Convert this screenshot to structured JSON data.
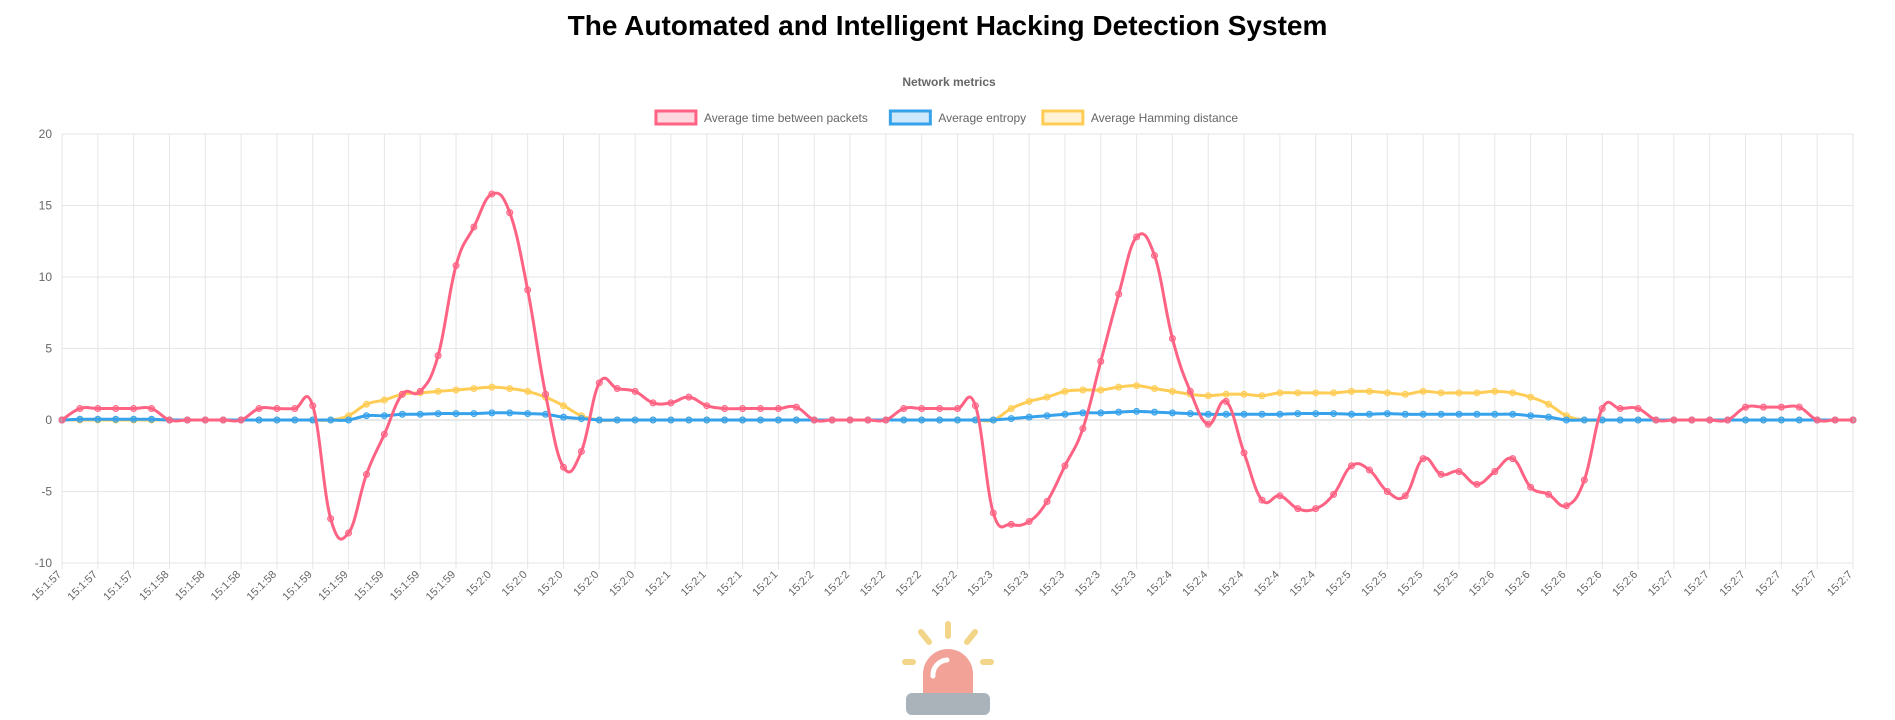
{
  "page": {
    "title": "The Automated and Intelligent Hacking Detection System"
  },
  "chart_data": {
    "type": "line",
    "title": "Network metrics",
    "xlabel": "",
    "ylabel": "",
    "ylim": [
      -10,
      20
    ],
    "yticks": [
      -10,
      -5,
      0,
      5,
      10,
      15,
      20
    ],
    "grid": true,
    "legend_position": "top",
    "categories": [
      "15:1:57",
      "15:1:57",
      "15:1:57",
      "15:1:58",
      "15:1:58",
      "15:1:58",
      "15:1:58",
      "15:1:59",
      "15:1:59",
      "15:1:59",
      "15:1:59",
      "15:1:59",
      "15:2:0",
      "15:2:0",
      "15:2:0",
      "15:2:0",
      "15:2:0",
      "15:2:1",
      "15:2:1",
      "15:2:1",
      "15:2:1",
      "15:2:2",
      "15:2:2",
      "15:2:2",
      "15:2:2",
      "15:2:2",
      "15:2:3",
      "15:2:3",
      "15:2:3",
      "15:2:3",
      "15:2:3",
      "15:2:4",
      "15:2:4",
      "15:2:4",
      "15:2:4",
      "15:2:4",
      "15:2:5",
      "15:2:5",
      "15:2:5",
      "15:2:5",
      "15:2:6",
      "15:2:6",
      "15:2:6",
      "15:2:6",
      "15:2:6",
      "15:2:7",
      "15:2:7",
      "15:2:7",
      "15:2:7",
      "15:2:7",
      "15:2:7"
    ],
    "points": [
      "15:1:57",
      "",
      "15:1:57",
      "",
      "15:1:57",
      "",
      "15:1:58",
      "",
      "15:1:58",
      "",
      "15:1:58",
      "",
      "15:1:58",
      "",
      "15:1:59",
      "",
      "15:1:59",
      "",
      "15:1:59",
      "",
      "15:1:59",
      "",
      "15:1:59",
      "",
      "15:2:0",
      "",
      "15:2:0",
      "",
      "15:2:0",
      "",
      "15:2:0",
      "",
      "15:2:0",
      "",
      "15:2:1",
      "",
      "15:2:1",
      "",
      "15:2:1",
      "",
      "15:2:1",
      "",
      "15:2:2",
      "",
      "15:2:2",
      "",
      "15:2:2",
      "",
      "15:2:2",
      "",
      "15:2:2",
      "",
      "15:2:3",
      "",
      "15:2:3",
      "",
      "15:2:3",
      "",
      "15:2:3",
      "",
      "15:2:3",
      "",
      "15:2:4",
      "",
      "15:2:4",
      "",
      "15:2:4",
      "",
      "15:2:4",
      "",
      "15:2:4",
      "",
      "15:2:5",
      "",
      "15:2:5",
      "",
      "15:2:5",
      "",
      "15:2:5",
      "",
      "15:2:6",
      "",
      "15:2:6",
      "",
      "15:2:6",
      "",
      "15:2:6",
      "",
      "15:2:6",
      "",
      "15:2:7",
      "",
      "15:2:7",
      "",
      "15:2:7",
      "",
      "15:2:7",
      "",
      "15:2:7"
    ],
    "series": [
      {
        "name": "Average time between packets",
        "color": "#ff6384",
        "values": [
          0,
          0.8,
          0.8,
          0.8,
          0.8,
          0.8,
          0,
          0,
          0,
          0,
          0,
          0.8,
          0.8,
          0.8,
          1,
          -6.9,
          -7.9,
          -3.8,
          -1,
          1.8,
          2,
          4.5,
          10.8,
          13.5,
          15.8,
          14.5,
          9.1,
          1.8,
          -3.3,
          -2.2,
          2.6,
          2.2,
          2,
          1.2,
          1.2,
          1.6,
          1,
          0.8,
          0.8,
          0.8,
          0.8,
          0.9,
          0,
          0,
          0,
          0,
          0,
          0.8,
          0.8,
          0.8,
          0.8,
          1,
          -6.5,
          -7.3,
          -7.1,
          -5.7,
          -3.2,
          -0.6,
          4.1,
          8.8,
          12.8,
          11.5,
          5.7,
          2,
          -0.3,
          1.3,
          -2.3,
          -5.6,
          -5.3,
          -6.2,
          -6.2,
          -5.2,
          -3.2,
          -3.5,
          -5,
          -5.3,
          -2.7,
          -3.8,
          -3.6,
          -4.5,
          -3.6,
          -2.7,
          -4.7,
          -5.2,
          -6,
          -4.2,
          0.8,
          0.8,
          0.8,
          0,
          0,
          0,
          0,
          0,
          0.9,
          0.9,
          0.9,
          0.9,
          0,
          0,
          0
        ]
      },
      {
        "name": "Average entropy",
        "color": "#36a2eb",
        "values": [
          0,
          0.05,
          0.05,
          0.05,
          0.05,
          0.05,
          0,
          0,
          0,
          0,
          0,
          0,
          0,
          0,
          0,
          0,
          0,
          0.3,
          0.3,
          0.4,
          0.4,
          0.45,
          0.45,
          0.45,
          0.5,
          0.5,
          0.45,
          0.4,
          0.2,
          0.1,
          0,
          0,
          0,
          0,
          0,
          0,
          0,
          0,
          0,
          0,
          0,
          0,
          0,
          0,
          0,
          0,
          0,
          0,
          0,
          0,
          0,
          0,
          0,
          0.1,
          0.2,
          0.3,
          0.4,
          0.5,
          0.5,
          0.55,
          0.6,
          0.55,
          0.5,
          0.45,
          0.4,
          0.4,
          0.4,
          0.4,
          0.4,
          0.45,
          0.45,
          0.45,
          0.4,
          0.4,
          0.45,
          0.4,
          0.4,
          0.4,
          0.4,
          0.4,
          0.4,
          0.4,
          0.3,
          0.2,
          0,
          0,
          0,
          0,
          0,
          0,
          0,
          0,
          0,
          0,
          0,
          0,
          0,
          0,
          0,
          0,
          0
        ]
      },
      {
        "name": "Average Hamming distance",
        "color": "#ffcd56",
        "values": [
          0,
          0,
          0,
          0,
          0,
          0,
          0,
          0,
          0,
          0,
          0,
          0,
          0,
          0,
          0,
          0,
          0.3,
          1.1,
          1.4,
          1.8,
          1.9,
          2,
          2.1,
          2.2,
          2.3,
          2.2,
          2,
          1.6,
          1,
          0.3,
          0,
          0,
          0,
          0,
          0,
          0,
          0,
          0,
          0,
          0,
          0,
          0,
          0,
          0,
          0,
          0,
          0,
          0,
          0,
          0,
          0,
          0,
          0,
          0.8,
          1.3,
          1.6,
          2,
          2.1,
          2.1,
          2.3,
          2.4,
          2.2,
          2,
          1.8,
          1.7,
          1.8,
          1.8,
          1.7,
          1.9,
          1.9,
          1.9,
          1.9,
          2,
          2,
          1.9,
          1.8,
          2,
          1.9,
          1.9,
          1.9,
          2,
          1.9,
          1.6,
          1.1,
          0.3,
          0,
          0,
          0,
          0,
          0,
          0,
          0,
          0,
          0,
          0,
          0,
          0,
          0,
          0,
          0,
          0
        ]
      }
    ]
  }
}
